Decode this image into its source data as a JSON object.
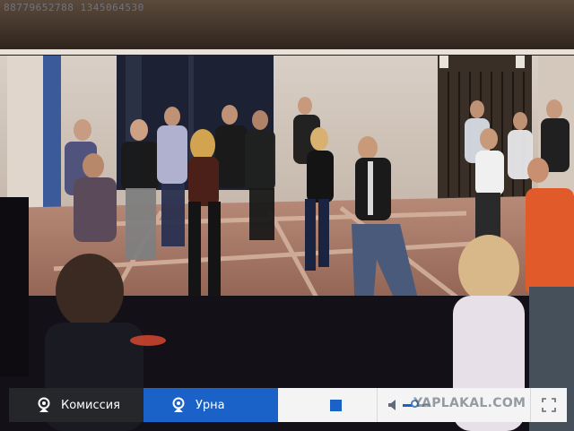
{
  "stream": {
    "overlay_stamp": "88779652788 1345064530"
  },
  "controls": {
    "commission_label": "Комиссия",
    "urna_label": "Урна",
    "volume_level": 0.45,
    "watermark": "YAPLAKAL.COM",
    "colors": {
      "accent": "#1a62c8",
      "dark_button": "#26282c",
      "bar_background": "#f4f4f4"
    }
  }
}
